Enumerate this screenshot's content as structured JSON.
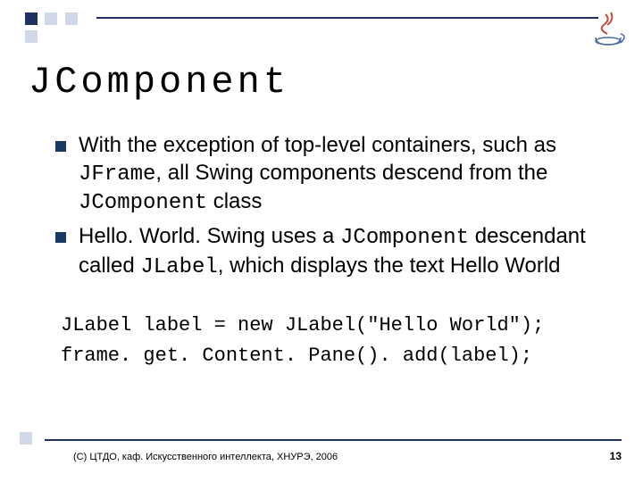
{
  "title": "JComponent",
  "bullets": [
    {
      "pre1": "With the exception of top-level containers, such as ",
      "code1": "JFrame",
      "mid1": ", all Swing components descend from the ",
      "code2": "JComponent",
      "post1": " class"
    },
    {
      "pre1": "Hello. World. Swing uses a ",
      "code1": "JComponent",
      "mid1": " descendant called ",
      "code2": "JLabel",
      "post1": ", which displays the text Hello World"
    }
  ],
  "code": {
    "line1": "JLabel label = new JLabel(\"Hello World\");",
    "line2": "frame. get. Content. Pane(). add(label);"
  },
  "footer": "(С) ЦТДО, каф. Искусственного интеллекта, ХНУРЭ, 2006",
  "page": "13",
  "logo_name": "java-duke-logo"
}
